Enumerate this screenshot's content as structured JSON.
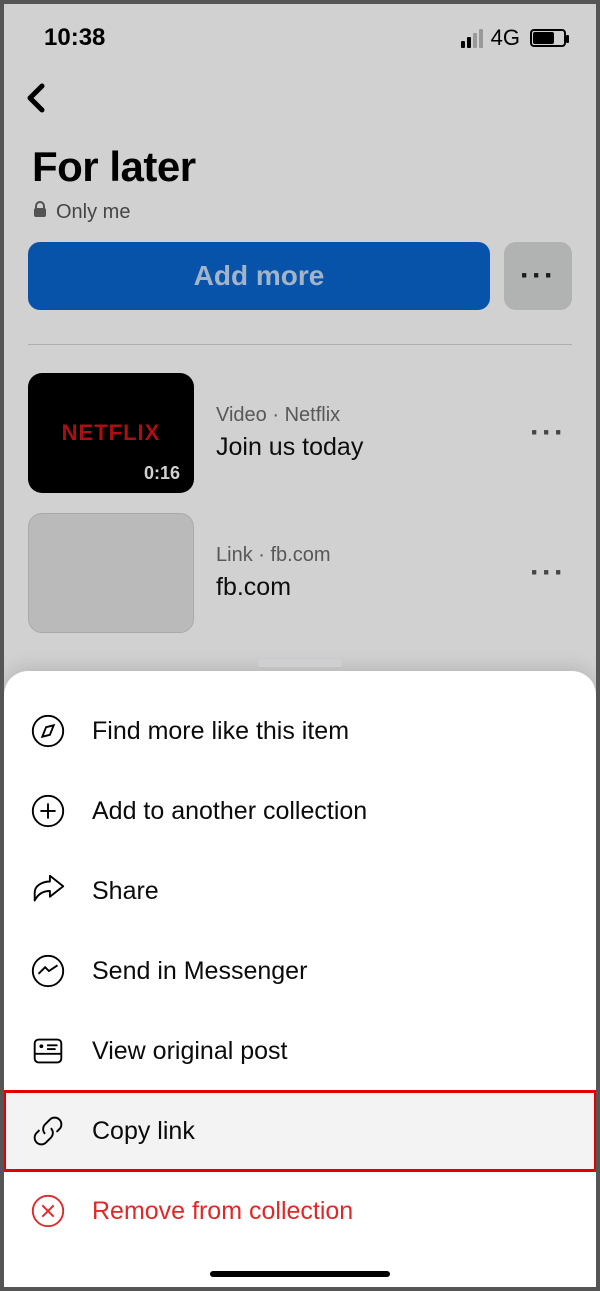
{
  "status": {
    "time": "10:38",
    "network": "4G"
  },
  "header": {
    "title": "For later",
    "privacy": "Only me",
    "add_more": "Add more"
  },
  "items": [
    {
      "kind": "Video",
      "source": "Netflix",
      "title": "Join us today",
      "duration": "0:16",
      "thumb_label": "NETFLIX"
    },
    {
      "kind": "Link",
      "source": "fb.com",
      "title": "fb.com"
    }
  ],
  "menu": {
    "find_more": "Find more like this item",
    "add_collection": "Add to another collection",
    "share": "Share",
    "send_messenger": "Send in Messenger",
    "view_original": "View original post",
    "copy_link": "Copy link",
    "remove": "Remove from collection"
  }
}
